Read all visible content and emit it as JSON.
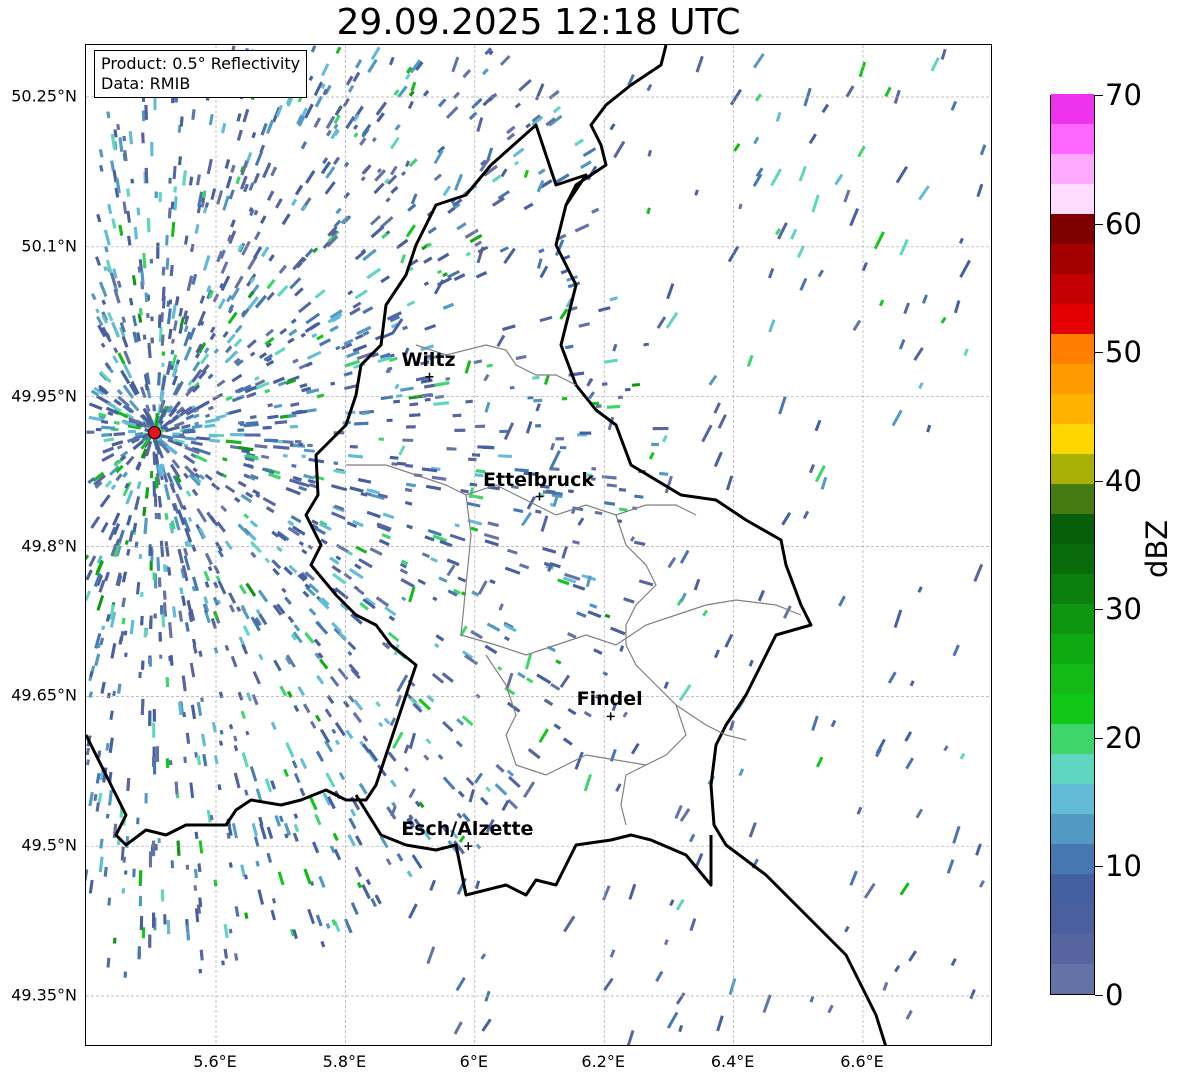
{
  "title": "29.09.2025 12:18 UTC",
  "info": {
    "product": "Product: 0.5° Reflectivity",
    "data": "Data: RMIB"
  },
  "map": {
    "lon_range": [
      5.4,
      6.8
    ],
    "lat_range": [
      49.3,
      50.3
    ],
    "lon_ticks": [
      {
        "value": 5.6,
        "label": "5.6°E"
      },
      {
        "value": 5.8,
        "label": "5.8°E"
      },
      {
        "value": 6.0,
        "label": "6°E"
      },
      {
        "value": 6.2,
        "label": "6.2°E"
      },
      {
        "value": 6.4,
        "label": "6.4°E"
      },
      {
        "value": 6.6,
        "label": "6.6°E"
      }
    ],
    "lat_ticks": [
      {
        "value": 50.25,
        "label": "50.25°N"
      },
      {
        "value": 50.1,
        "label": "50.1°N"
      },
      {
        "value": 49.95,
        "label": "49.95°N"
      },
      {
        "value": 49.8,
        "label": "49.8°N"
      },
      {
        "value": 49.65,
        "label": "49.65°N"
      },
      {
        "value": 49.5,
        "label": "49.5°N"
      },
      {
        "value": 49.35,
        "label": "49.35°N"
      }
    ],
    "cities": [
      {
        "name": "Wiltz",
        "lon": 5.93,
        "lat": 49.97
      },
      {
        "name": "Ettelbruck",
        "lon": 6.1,
        "lat": 49.85
      },
      {
        "name": "Findel",
        "lon": 6.21,
        "lat": 49.63
      },
      {
        "name": "Esch/Alzette",
        "lon": 5.99,
        "lat": 49.5
      }
    ],
    "radar_site": {
      "lon": 5.505,
      "lat": 49.914,
      "color": "#e8131b"
    },
    "border_color": "#000000",
    "canton_color": "#808080"
  },
  "colorbar": {
    "label": "dBZ",
    "min": 0,
    "max": 70,
    "tick_labels": [
      "0",
      "10",
      "20",
      "30",
      "40",
      "50",
      "60",
      "70"
    ],
    "colors": [
      "#6473a6",
      "#5665a0",
      "#4a609e",
      "#4560a0",
      "#4677b0",
      "#5299c4",
      "#62bcd8",
      "#5ed6c0",
      "#3ed66a",
      "#11c819",
      "#13b914",
      "#0faa12",
      "#0e9610",
      "#0b800e",
      "#0a6b0c",
      "#076009",
      "#457b10",
      "#aab105",
      "#ffd700",
      "#ffb300",
      "#ff9a00",
      "#ff7f00",
      "#e40000",
      "#c40000",
      "#a40000",
      "#800000",
      "#ffdcff",
      "#ffaaff",
      "#ff66ff",
      "#ee33ee"
    ]
  }
}
